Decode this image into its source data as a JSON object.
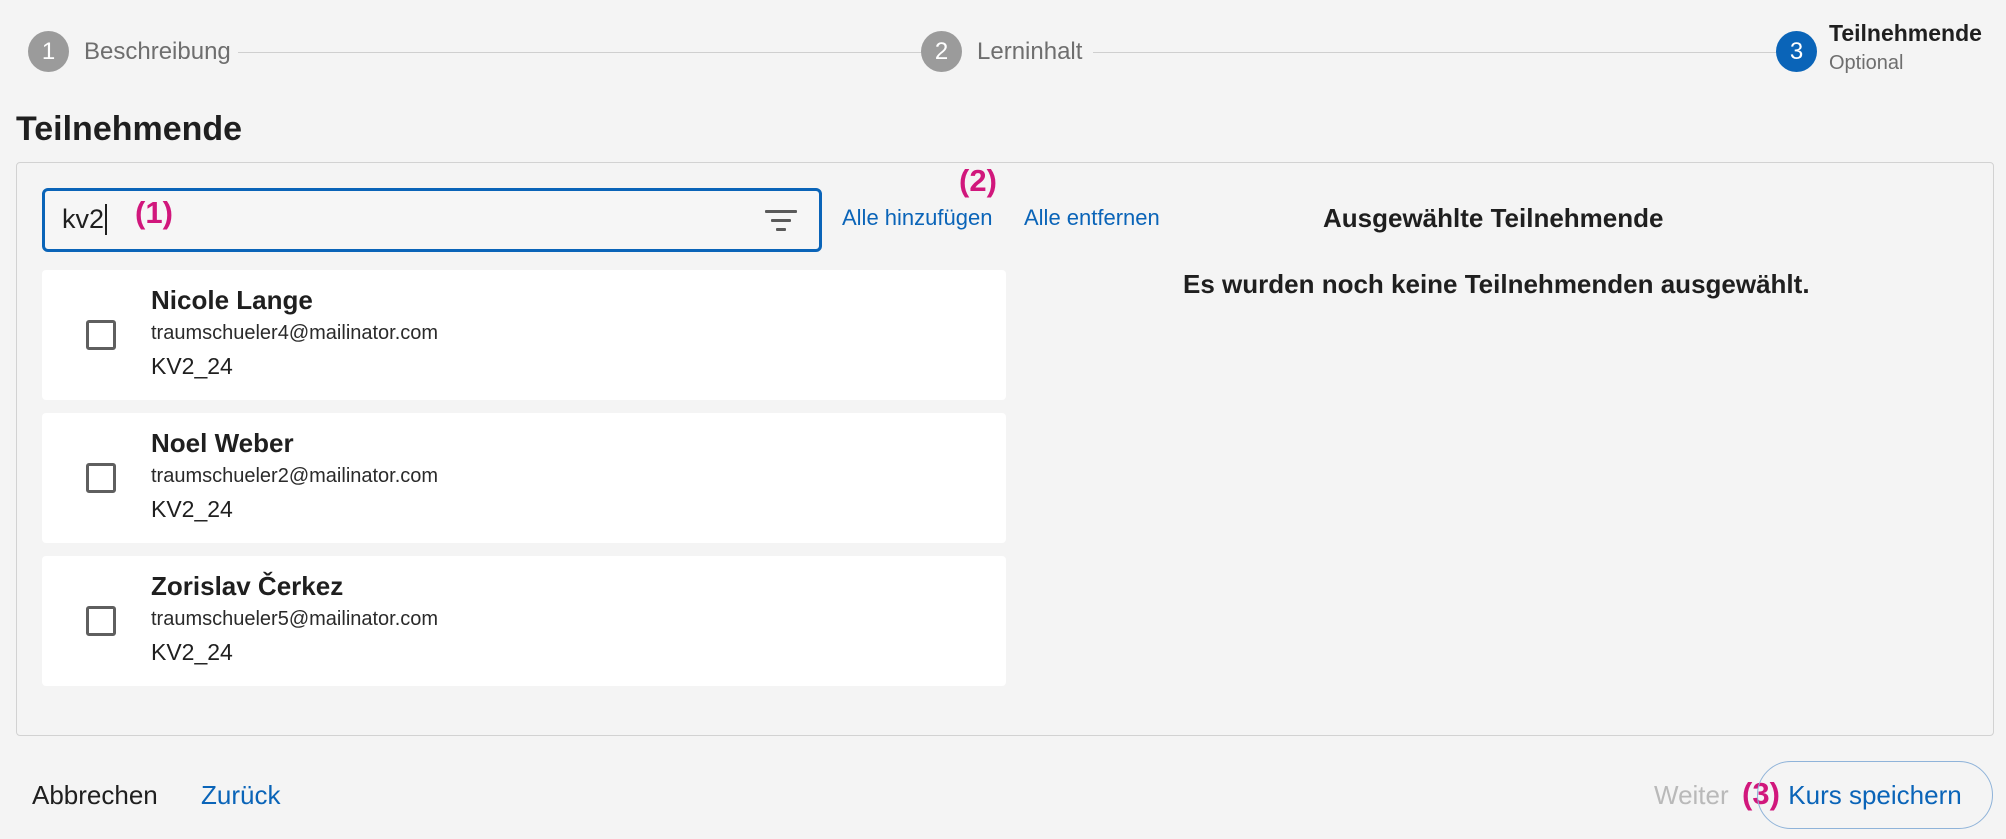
{
  "stepper": {
    "steps": [
      {
        "number": "1",
        "label": "Beschreibung"
      },
      {
        "number": "2",
        "label": "Lerninhalt"
      },
      {
        "number": "3",
        "label": "Teilnehmende",
        "sublabel": "Optional"
      }
    ],
    "active_step": "3"
  },
  "page_title": "Teilnehmende",
  "search": {
    "value": "kv2",
    "filter_icon": "filter-icon"
  },
  "actions": {
    "add_all": "Alle hinzufügen",
    "remove_all": "Alle entfernen"
  },
  "annotations": {
    "one": "(1)",
    "two": "(2)",
    "three": "(3)"
  },
  "selected": {
    "title": "Ausgewählte Teilnehmende",
    "empty_message": "Es wurden noch keine Teilnehmenden ausgewählt."
  },
  "participants": [
    {
      "name": "Nicole Lange",
      "email": "traumschueler4@mailinator.com",
      "group": "KV2_24",
      "checked": false
    },
    {
      "name": "Noel Weber",
      "email": "traumschueler2@mailinator.com",
      "group": "KV2_24",
      "checked": false
    },
    {
      "name": "Zorislav Čerkez",
      "email": "traumschueler5@mailinator.com",
      "group": "KV2_24",
      "checked": false
    }
  ],
  "footer": {
    "cancel": "Abbrechen",
    "back": "Zurück",
    "next": "Weiter",
    "save": "Kurs speichern"
  },
  "colors": {
    "accent": "#0a64b8",
    "annotation": "#d1177c",
    "inactive_step": "#9b9b9b",
    "disabled_text": "#b9b9b9"
  }
}
